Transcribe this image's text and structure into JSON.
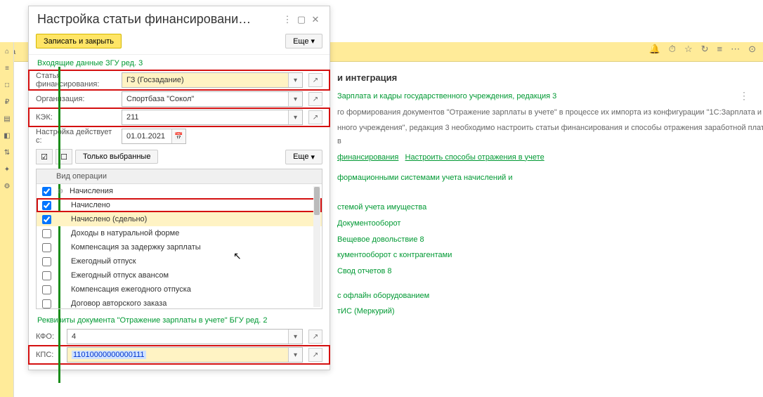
{
  "topNav": {
    "home": "Ha"
  },
  "topIcons": [
    "🔔",
    "⏱",
    "☆",
    "↻",
    "≡",
    "⋯",
    "⊙"
  ],
  "bg": {
    "header": "и интеграция",
    "line1": "Зарплата и кадры государственного учреждения, редакция 3",
    "desc1": "го формирования документов \"Отражение зарплаты в учете\" в процессе их импорта из конфигурации \"1С:Зарплата и",
    "desc2": "нного учреждения\", редакция 3 необходимо настроить статьи финансирования и способы отражения заработной платы в",
    "link1": "финансирования",
    "link2": "Настроить способы отражения в учете",
    "line2": "формационными системами учета начислений и",
    "line3": "стемой учета имущества",
    "line4": "Документооборот",
    "line5": "Вещевое довольствие 8",
    "line6": "кументооборот с контрагентами",
    "line7": "Свод отчетов 8",
    "line8": "с офлайн оборудованием",
    "line9": "тИС (Меркурий)"
  },
  "dialog": {
    "title": "Настройка статьи финансировани…",
    "save": "Записать и закрыть",
    "more": "Еще",
    "sec1": "Входящие данные ЗГУ ред. 3",
    "fields": {
      "finArtLabel": "Статья финансирования:",
      "finArtVal": "ГЗ (Госзадание)",
      "orgLabel": "Организация:",
      "orgVal": "Спортбаза \"Сокол\"",
      "kekLabel": "КЭК:",
      "kekVal": "211",
      "dateLabel": "Настройка действует с:",
      "dateVal": "01.01.2021"
    },
    "onlySelected": "Только выбранные",
    "tableHeader": "Вид операции",
    "rows": [
      {
        "label": "Начисления",
        "checked": true,
        "group": true
      },
      {
        "label": "Начислено",
        "checked": true,
        "red": true
      },
      {
        "label": "Начислено (сдельно)",
        "checked": true,
        "sel": true
      },
      {
        "label": "Доходы в натуральной форме",
        "checked": false
      },
      {
        "label": "Компенсация за задержку зарплаты",
        "checked": false
      },
      {
        "label": "Ежегодный отпуск",
        "checked": false
      },
      {
        "label": "Ежегодный отпуск авансом",
        "checked": false
      },
      {
        "label": "Компенсация ежегодного отпуска",
        "checked": false
      },
      {
        "label": "Договор авторского заказа",
        "checked": false
      }
    ],
    "sec2": "Реквизиты документа \"Отражение зарплаты в учете\" БГУ ред. 2",
    "kfoLabel": "КФО:",
    "kfoVal": "4",
    "kpsLabel": "КПС:",
    "kpsVal": "11010000000000111"
  }
}
